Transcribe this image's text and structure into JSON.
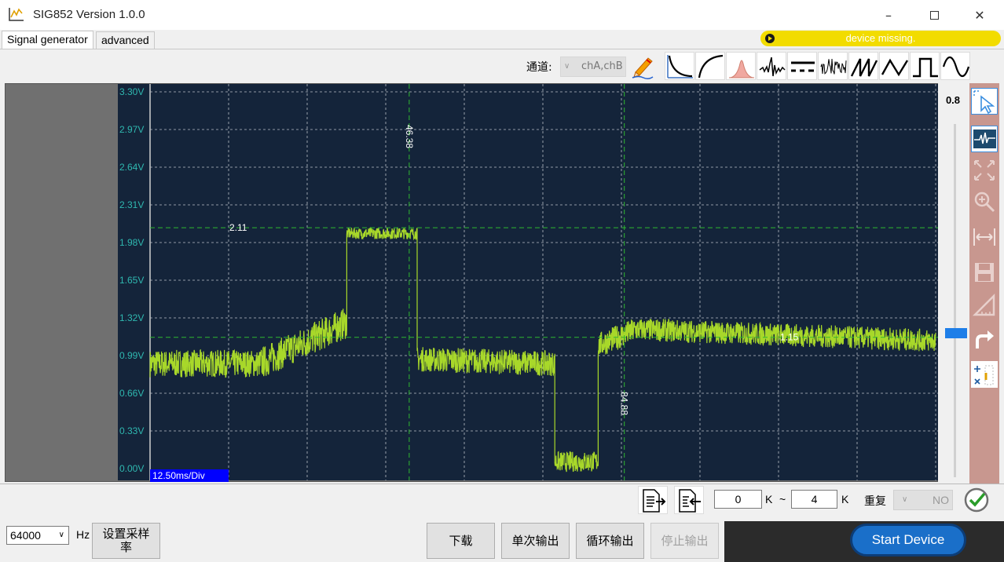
{
  "window": {
    "title": "SIG852  Version 1.0.0",
    "minimize_icon": "minimize-icon",
    "maximize_icon": "maximize-icon",
    "close_icon": "close-icon"
  },
  "tabs": [
    {
      "label": "Signal generator",
      "active": true
    },
    {
      "label": "advanced",
      "active": false
    }
  ],
  "status": {
    "text": "device  missing.",
    "color": "#f2dc00"
  },
  "toolbar": {
    "channel_label": "通道:",
    "channel_value": "chA,chB",
    "waveform_icons": [
      "pen-icon",
      "exp-decay-icon",
      "log-rise-icon",
      "gaussian-icon",
      "noise-spike-icon",
      "dc-icon",
      "noise-icon",
      "sawtooth-icon",
      "triangle-icon",
      "square-icon",
      "sine-icon"
    ]
  },
  "scope": {
    "y_ticks": [
      "3.30V",
      "2.97V",
      "2.64V",
      "2.31V",
      "1.98V",
      "1.65V",
      "1.32V",
      "0.99V",
      "0.66V",
      "0.33V",
      "0.00V"
    ],
    "time_div": "12.50ms/Div",
    "cursor_h1_label": "2.11",
    "cursor_h2_label": "1.15",
    "cursor_v1_label": "46.38",
    "cursor_v2_label": "84.88",
    "trace_color": "#a8d82a",
    "background_color": "#14243a"
  },
  "chart_data": {
    "type": "line",
    "ylim": [
      0,
      3.3
    ],
    "y_unit": "V",
    "x_div": "12.50ms/Div",
    "x_divisions": 10,
    "segments": [
      {
        "x": [
          0,
          17.5
        ],
        "y": [
          0.92,
          0.92
        ],
        "noise": 0.12
      },
      {
        "x": [
          17.5,
          31.3
        ],
        "y": [
          0.92,
          1.28
        ],
        "noise": 0.14
      },
      {
        "x": [
          31.3,
          42.5
        ],
        "y": [
          2.06,
          2.06
        ],
        "noise": 0.05
      },
      {
        "x": [
          42.5,
          64.4
        ],
        "y": [
          0.96,
          0.92
        ],
        "noise": 0.11
      },
      {
        "x": [
          64.4,
          71.3
        ],
        "y": [
          0.06,
          0.06
        ],
        "noise": 0.09
      },
      {
        "x": [
          71.3,
          77.5
        ],
        "y": [
          1.08,
          1.22
        ],
        "noise": 0.11
      },
      {
        "x": [
          77.5,
          125
        ],
        "y": [
          1.22,
          1.12
        ],
        "noise": 0.1
      }
    ],
    "cursors": {
      "h": [
        2.11,
        1.15
      ],
      "v": [
        46.38,
        84.88
      ]
    }
  },
  "slider": {
    "value": "0.8",
    "level": 0.2
  },
  "right_tools": [
    "pointer-icon",
    "waveform-view-icon",
    "fit-icon",
    "zoom-icon",
    "horizontal-zoom-icon",
    "save-icon",
    "measure-icon",
    "redo-icon",
    "add-icon"
  ],
  "bottom_toolbar": {
    "export_icon": "export-file-icon",
    "import_icon": "import-file-icon",
    "range_from": "0",
    "range_unit_1": "K",
    "range_sep": "~",
    "range_to": "4",
    "range_unit_2": "K",
    "repeat_label": "重复",
    "repeat_value": "NO",
    "confirm_icon": "check-circle-icon"
  },
  "bottom_bar": {
    "sample_rate": "64000",
    "hz_label": "Hz",
    "set_rate_button": "设置采样\n率",
    "download_button": "下载",
    "single_output_button": "单次输出",
    "loop_output_button": "循环输出",
    "stop_output_button": "停止输出",
    "start_button": "Start Device"
  }
}
